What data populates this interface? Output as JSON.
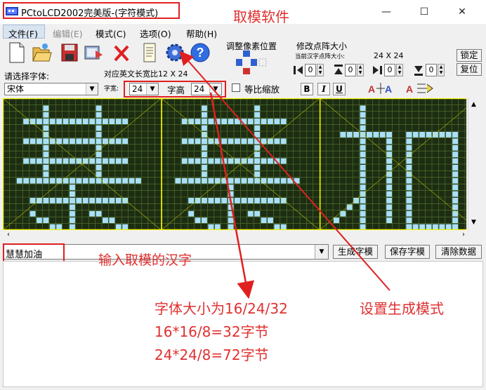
{
  "window": {
    "title": "PCtoLCD2002完美版-(字符模式)",
    "minimize": "—",
    "maximize": "☐",
    "close": "✕"
  },
  "menu": [
    "文件(F)",
    "编辑(E)",
    "模式(C)",
    "选项(O)",
    "帮助(H)"
  ],
  "toolbar_icons": [
    "new-document-icon",
    "open-folder-icon",
    "save-disk-icon",
    "export-icon",
    "delete-x-icon",
    "notepad-icon",
    "gear-icon",
    "help-icon"
  ],
  "pixel_position": {
    "title": "调整像素位置"
  },
  "dot_matrix": {
    "title": "修改点阵大小",
    "current_label": "当前汉字点阵大小:",
    "current_value": "24 X 24",
    "lock_label": "锁定",
    "restore_label": "复位",
    "values": [
      "0",
      "0",
      "0",
      "0"
    ]
  },
  "font": {
    "label": "请选择字体:",
    "value": "宋体",
    "ratio_label": "对应英文长宽比12 X 24",
    "width_label": "字宽:",
    "width_value": "24",
    "height_label": "字高",
    "height_value": "24",
    "scale_label": "等比缩放",
    "bold": "B",
    "italic": "I",
    "underline": "U"
  },
  "input": {
    "value": "慧慧加油"
  },
  "buttons": {
    "generate": "生成字模",
    "save": "保存字模",
    "clear": "清除数据"
  },
  "annotations": {
    "software": "取模软件",
    "input_hint": "输入取模的汉字",
    "size_line1": "字体大小为16/24/32",
    "size_line2": "16*16/8=32字节",
    "size_line3": "24*24/8=72字节",
    "mode_hint": "设置生成模式"
  },
  "colors": {
    "grid_bg": "#1c2d12",
    "grid_line": "#5b7a33",
    "lit_pixel": "#a9e0f7",
    "cell_border": "#f2f200",
    "annotation": "#e02020"
  }
}
